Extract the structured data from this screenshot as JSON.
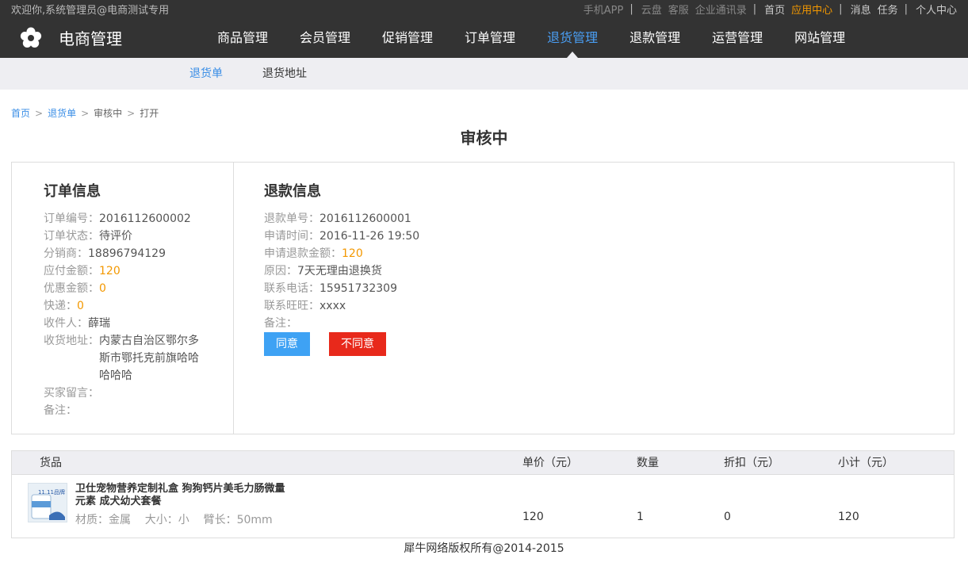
{
  "topbar": {
    "welcome": "欢迎你,系统管理员@电商测试专用",
    "links_dim": [
      "手机APP",
      "云盘",
      "客服",
      "企业通讯录"
    ],
    "home": "首页",
    "app_center": "应用中心",
    "messages": "消息",
    "tasks": "任务",
    "personal": "个人中心",
    "separator": "|"
  },
  "brand": {
    "title": "电商管理",
    "logo_icon": "flower-icon"
  },
  "menu": [
    "商品管理",
    "会员管理",
    "促销管理",
    "订单管理",
    "退货管理",
    "退款管理",
    "运营管理",
    "网站管理"
  ],
  "menu_active_index": 4,
  "subnav": {
    "items": [
      "退货单",
      "退货地址"
    ],
    "active_index": 0
  },
  "breadcrumb": {
    "home": "首页",
    "list": "退货单",
    "status": "审核中",
    "current": "打开",
    "sep": ">"
  },
  "status_title": "审核中",
  "order": {
    "title": "订单信息",
    "rows": [
      {
        "label": "订单编号：",
        "value": "2016112600002"
      },
      {
        "label": "订单状态：",
        "value": "待评价"
      },
      {
        "label": "分销商：",
        "value": "18896794129"
      },
      {
        "label": "应付金额：",
        "value": "120"
      },
      {
        "label": "优惠金额：",
        "value": "0"
      },
      {
        "label": "快递：",
        "value": "0"
      },
      {
        "label": "收件人：",
        "value": "薛瑞"
      },
      {
        "label": "收货地址：",
        "value": "内蒙古自治区鄂尔多斯市鄂托克前旗哈哈哈哈哈"
      },
      {
        "label": "买家留言：",
        "value": ""
      },
      {
        "label": "备注：",
        "value": ""
      }
    ]
  },
  "refund": {
    "title": "退款信息",
    "rows": [
      {
        "label": "退款单号：",
        "value": "2016112600001"
      },
      {
        "label": "申请时间：",
        "value": "2016-11-26 19:50"
      },
      {
        "label": "申请退款金额：",
        "value": "120"
      },
      {
        "label": "原因：",
        "value": "7天无理由退换货"
      },
      {
        "label": "联系电话：",
        "value": "15951732309"
      },
      {
        "label": "联系旺旺：",
        "value": "xxxx"
      },
      {
        "label": "备注：",
        "value": ""
      }
    ],
    "agree_label": "同意",
    "reject_label": "不同意"
  },
  "goods": {
    "headers": [
      "货品",
      "单价（元）",
      "数量",
      "折扣（元）",
      "小计（元）"
    ],
    "item": {
      "name": "卫仕宠物营养定制礼盒 狗狗钙片美毛力肠微量元素 成犬幼犬套餐",
      "attrs": "材质：金属    大小：小    臂长：50mm",
      "thumb_text": "11.11品牌",
      "price": "120",
      "qty": "1",
      "discount": "0",
      "subtotal": "120"
    }
  },
  "footer": "犀牛网络版权所有@2014-2015",
  "colors": {
    "accent": "#3a8ee6",
    "orange": "#f39800",
    "agree": "#3ea2f4",
    "reject": "#e8291b",
    "dark": "#333333"
  }
}
